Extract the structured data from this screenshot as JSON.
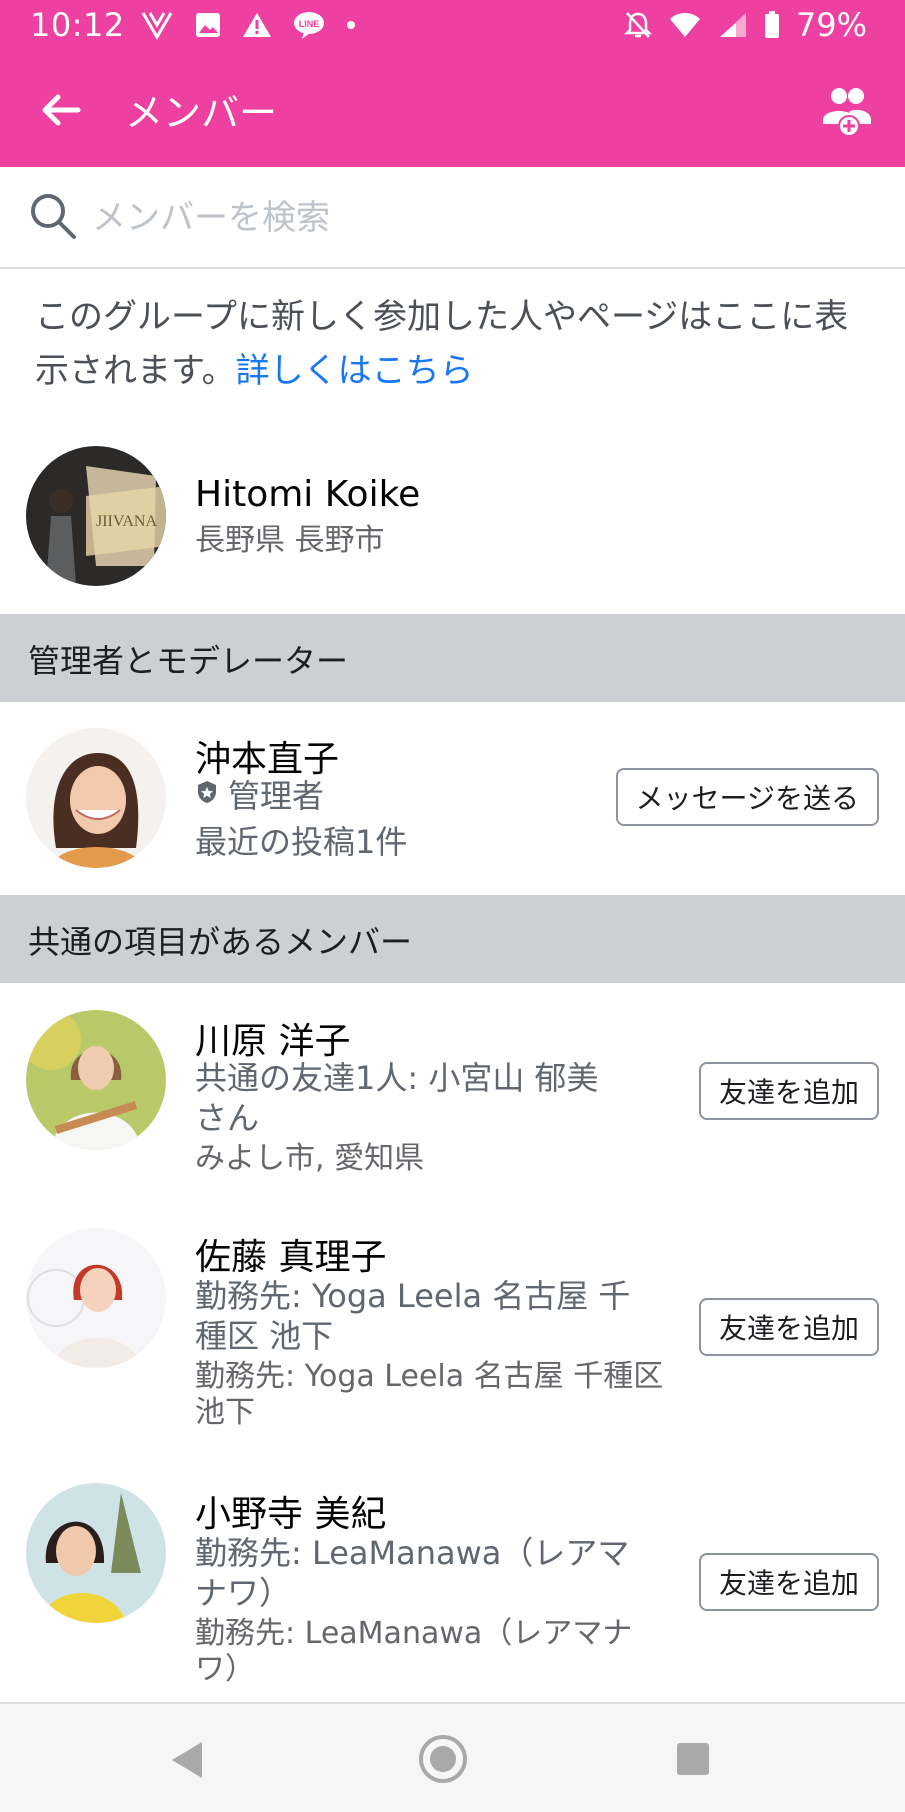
{
  "status": {
    "time": "10:12",
    "battery": "79%"
  },
  "header": {
    "title": "メンバー"
  },
  "search": {
    "placeholder": "メンバーを検索"
  },
  "info": {
    "text": "このグループに新しく参加した人やページはここに表示されます。",
    "link": "詳しくはこちら"
  },
  "new_member": {
    "name": "Hitomi Koike",
    "location": "長野県 長野市"
  },
  "admins": {
    "header": "管理者とモデレーター",
    "member": {
      "name": "沖本直子",
      "role": "管理者",
      "posts": "最近の投稿1件",
      "button": "メッセージを送る"
    }
  },
  "common": {
    "header": "共通の項目があるメンバー",
    "members": [
      {
        "name": "川原 洋子",
        "line1": "共通の友達1人: 小宮山 郁美",
        "line1b": "さん",
        "line2": "みよし市, 愛知県",
        "button": "友達を追加"
      },
      {
        "name": "佐藤 真理子",
        "line1": "勤務先: Yoga Leela 名古屋 千",
        "line1b": "種区 池下",
        "line2": "勤務先: Yoga Leela 名古屋 千種区",
        "line2b": "池下",
        "button": "友達を追加"
      },
      {
        "name": "小野寺 美紀",
        "line1": "勤務先: LeaManawa（レアマ",
        "line1b": "ナワ）",
        "line2": "勤務先: LeaManawa（レアマナ",
        "line2b": "ワ）",
        "button": "友達を追加"
      }
    ]
  },
  "colors": {
    "brand": "#ee40a1",
    "link": "#1877f2",
    "section": "#ccd0d5"
  }
}
